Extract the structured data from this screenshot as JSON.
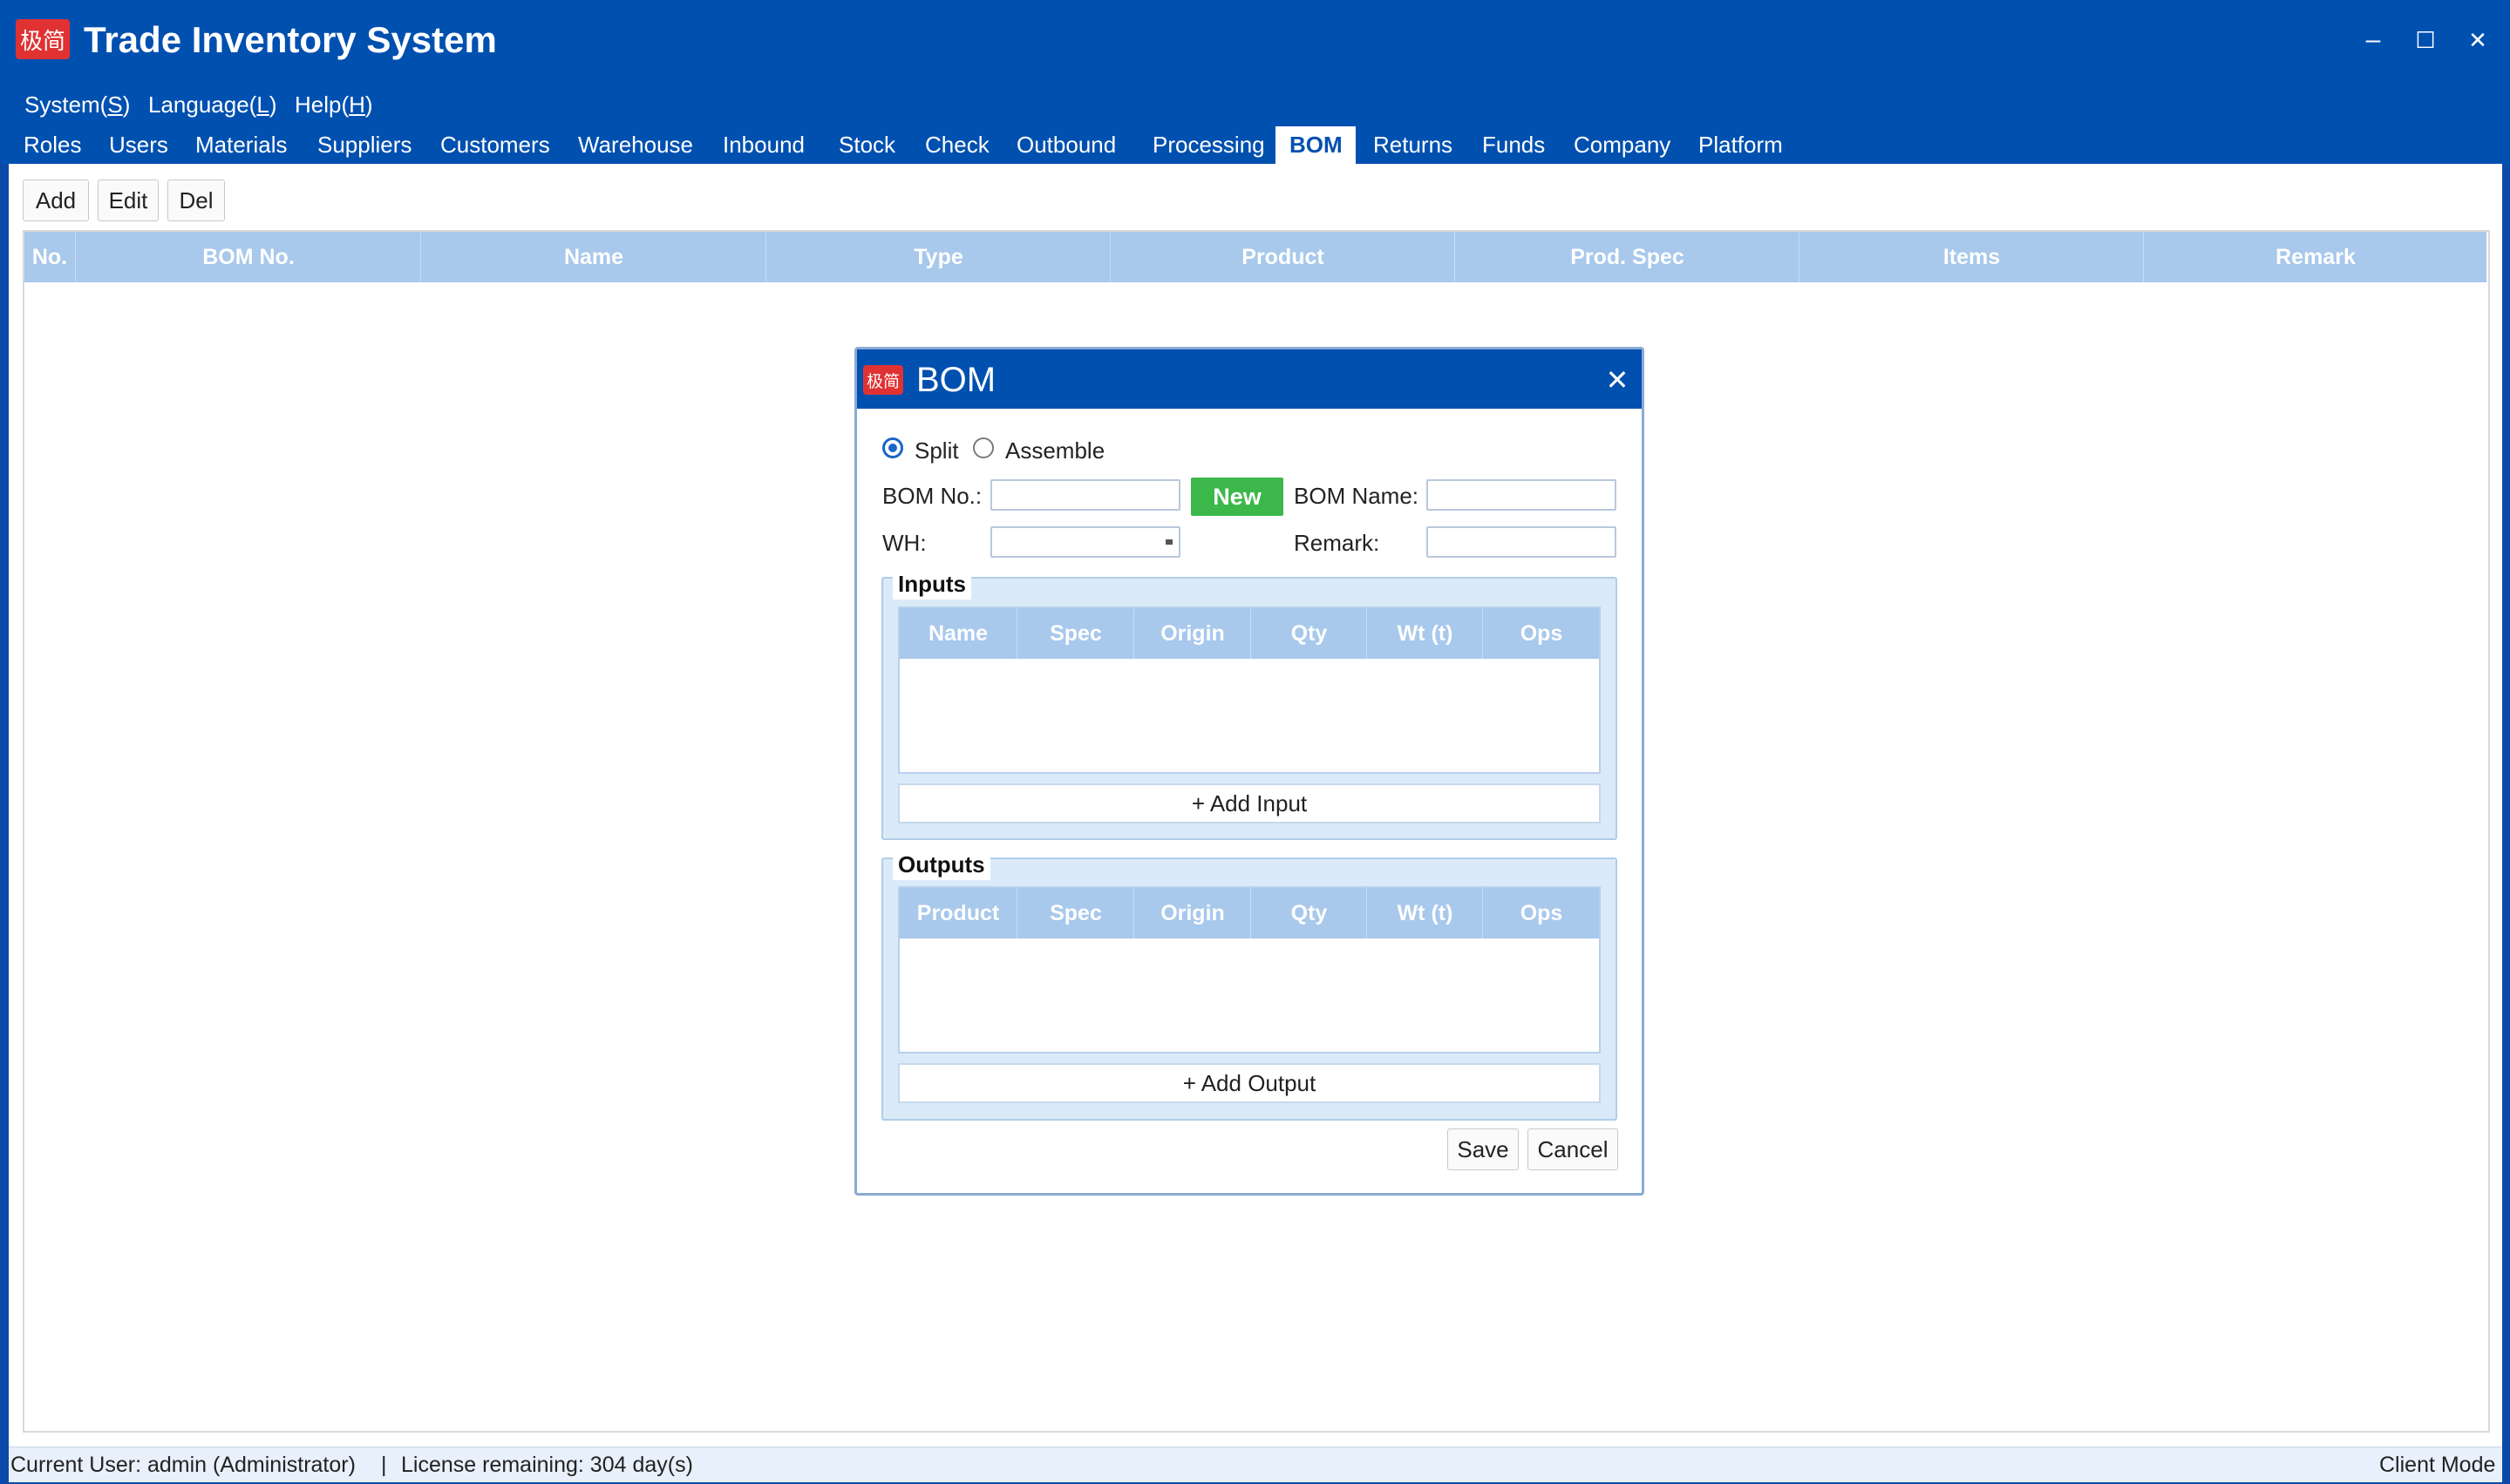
{
  "app": {
    "logo_text": "极简",
    "title": "Trade Inventory System",
    "window_controls": {
      "minimize": "–",
      "maximize": "☐",
      "close": "✕"
    }
  },
  "menu": [
    "System(S)",
    "Language(L)",
    "Help(H)"
  ],
  "menu_parts": [
    {
      "text": "System(",
      "key": "S",
      "end": ")"
    },
    {
      "text": "Language(",
      "key": "L",
      "end": ")"
    },
    {
      "text": "Help(",
      "key": "H",
      "end": ")"
    }
  ],
  "tabs": [
    "Roles",
    "Users",
    "Materials",
    "Suppliers",
    "Customers",
    "Warehouse",
    "Inbound",
    "Stock",
    "Check",
    "Outbound",
    "Processing",
    "BOM",
    "Returns",
    "Funds",
    "Company",
    "Platform"
  ],
  "active_tab": "BOM",
  "toolbar": {
    "add": "Add",
    "edit": "Edit",
    "del": "Del"
  },
  "grid": {
    "columns": [
      "No.",
      "BOM No.",
      "Name",
      "Type",
      "Product",
      "Prod. Spec",
      "Items",
      "Remark"
    ],
    "rows": []
  },
  "dialog": {
    "logo_text": "极简",
    "title": "BOM",
    "close": "✕",
    "mode_options": [
      "Split",
      "Assemble"
    ],
    "mode_selected": "Split",
    "bom_no_label": "BOM No.:",
    "bom_no_value": "",
    "new_button": "New",
    "bom_name_label": "BOM Name:",
    "bom_name_value": "",
    "wh_label": "WH:",
    "wh_value": "",
    "remark_label": "Remark:",
    "remark_value": "",
    "inputs": {
      "title": "Inputs",
      "columns": [
        "Name",
        "Spec",
        "Origin",
        "Qty",
        "Wt (t)",
        "Ops"
      ],
      "rows": [],
      "add_label": "+ Add Input"
    },
    "outputs": {
      "title": "Outputs",
      "columns": [
        "Product",
        "Spec",
        "Origin",
        "Qty",
        "Wt (t)",
        "Ops"
      ],
      "rows": [],
      "add_label": "+ Add Output"
    },
    "save": "Save",
    "cancel": "Cancel"
  },
  "status": {
    "user": "Current User: admin (Administrator)",
    "separator": "|",
    "license": "License remaining: 304 day(s)",
    "mode": "Client Mode"
  },
  "colors": {
    "brand_blue": "#0050b0",
    "header_blue": "#a8c8ec",
    "new_green": "#3cb84a",
    "logo_red": "#e03232"
  }
}
